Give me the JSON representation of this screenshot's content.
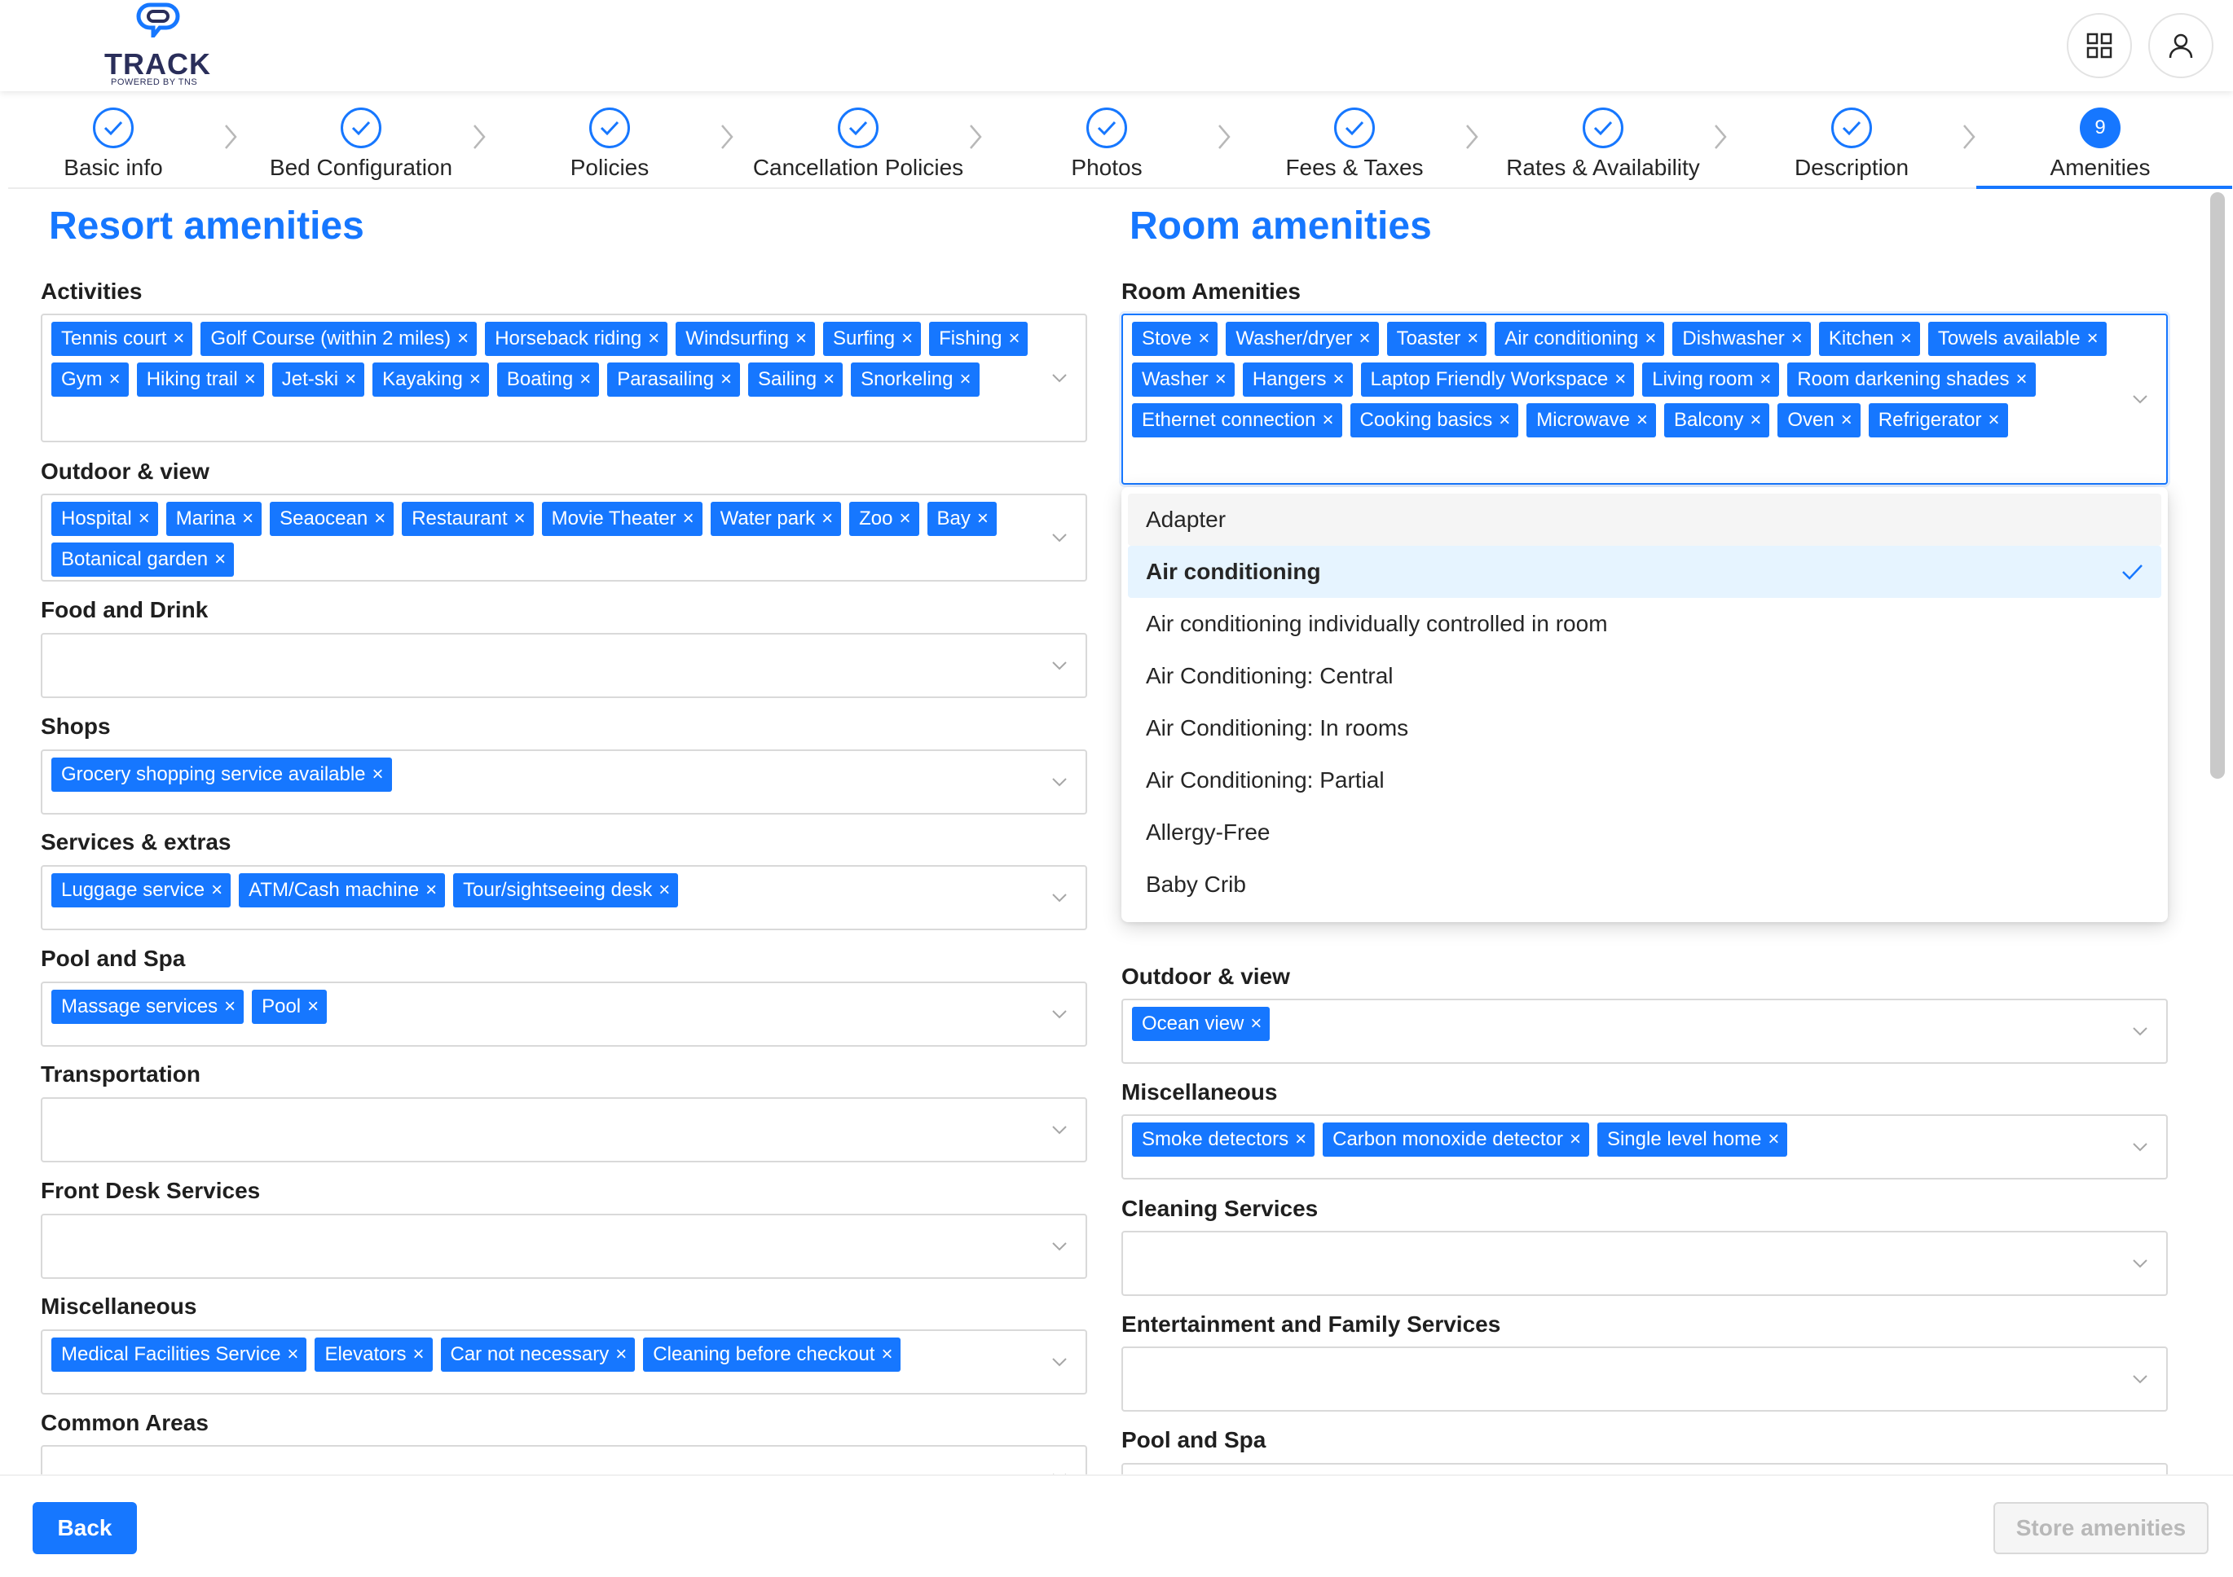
{
  "logo": {
    "title": "TRACK",
    "subtitle": "POWERED BY TNS"
  },
  "header": {
    "apps_icon": "grid-icon",
    "user_icon": "user-icon"
  },
  "steps": [
    {
      "label": "Basic info",
      "status": "done"
    },
    {
      "label": "Bed Configuration",
      "status": "done"
    },
    {
      "label": "Policies",
      "status": "done"
    },
    {
      "label": "Cancellation Policies",
      "status": "done"
    },
    {
      "label": "Photos",
      "status": "done"
    },
    {
      "label": "Fees & Taxes",
      "status": "done"
    },
    {
      "label": "Rates & Availability",
      "status": "done"
    },
    {
      "label": "Description",
      "status": "done"
    },
    {
      "label": "Amenities",
      "status": "active",
      "number": "9"
    }
  ],
  "resort": {
    "title": "Resort amenities",
    "fields": [
      {
        "label": "Activities",
        "tags": [
          "Tennis court",
          "Golf Course (within 2 miles)",
          "Horseback riding",
          "Windsurfing",
          "Surfing",
          "Fishing",
          "Gym",
          "Hiking trail",
          "Jet-ski",
          "Kayaking",
          "Boating",
          "Parasailing",
          "Sailing",
          "Snorkeling"
        ]
      },
      {
        "label": "Outdoor & view",
        "tags": [
          "Hospital",
          "Marina",
          "Seaocean",
          "Restaurant",
          "Movie Theater",
          "Water park",
          "Zoo",
          "Bay",
          "Botanical garden"
        ]
      },
      {
        "label": "Food and Drink",
        "tags": []
      },
      {
        "label": "Shops",
        "tags": [
          "Grocery shopping service available"
        ]
      },
      {
        "label": "Services & extras",
        "tags": [
          "Luggage service",
          "ATM/Cash machine",
          "Tour/sightseeing desk"
        ]
      },
      {
        "label": "Pool and Spa",
        "tags": [
          "Massage services",
          "Pool"
        ]
      },
      {
        "label": "Transportation",
        "tags": []
      },
      {
        "label": "Front Desk Services",
        "tags": []
      },
      {
        "label": "Miscellaneous",
        "tags": [
          "Medical Facilities Service",
          "Elevators",
          "Car not necessary",
          "Cleaning before checkout"
        ]
      },
      {
        "label": "Common Areas",
        "tags": []
      }
    ]
  },
  "room": {
    "title": "Room amenities",
    "fields": [
      {
        "label": "Room Amenities",
        "tags": [
          "Stove",
          "Washer/dryer",
          "Toaster",
          "Air conditioning",
          "Dishwasher",
          "Kitchen",
          "Towels available",
          "Washer",
          "Hangers",
          "Laptop Friendly Workspace",
          "Living room",
          "Room darkening shades",
          "Ethernet connection",
          "Cooking basics",
          "Microwave",
          "Balcony",
          "Oven",
          "Refrigerator"
        ]
      },
      {
        "label": "Outdoor & view",
        "tags": [
          "Ocean view"
        ]
      },
      {
        "label": "Miscellaneous",
        "tags": [
          "Smoke detectors",
          "Carbon monoxide detector",
          "Single level home"
        ]
      },
      {
        "label": "Cleaning Services",
        "tags": []
      },
      {
        "label": "Entertainment and Family Services",
        "tags": []
      },
      {
        "label": "Pool and Spa",
        "tags": []
      }
    ]
  },
  "dropdown": {
    "options": [
      "Adapter",
      "Air conditioning",
      "Air conditioning individually controlled in room",
      "Air Conditioning: Central",
      "Air Conditioning: In rooms",
      "Air Conditioning: Partial",
      "Allergy-Free",
      "Baby Crib"
    ],
    "selected": "Air conditioning",
    "hovered": "Adapter"
  },
  "footer": {
    "back_label": "Back",
    "store_label": "Store amenities"
  },
  "colors": {
    "primary": "#1677ff",
    "text": "#1f1f1f",
    "border": "#d9d9d9"
  }
}
